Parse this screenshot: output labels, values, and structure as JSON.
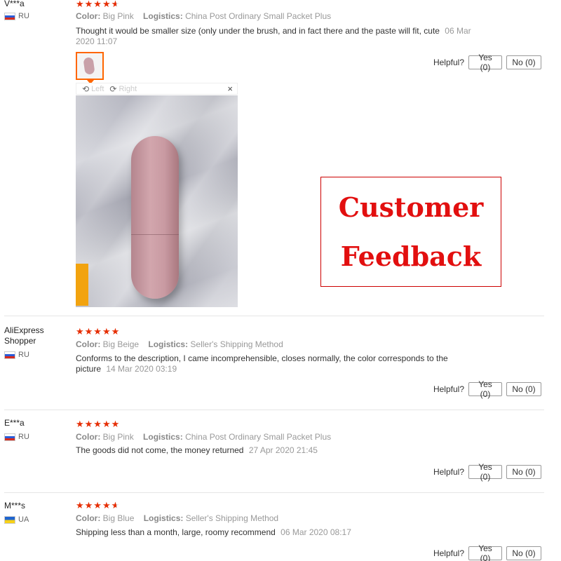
{
  "labels": {
    "color": "Color:",
    "logistics": "Logistics:",
    "helpful": "Helpful?",
    "rotate_left": "Left",
    "rotate_right": "Right",
    "close": "×"
  },
  "banner": {
    "line1": "Customer",
    "line2": "Feedback",
    "color": "#e20f0f"
  },
  "colors": {
    "star": "#e62e04",
    "thumb_border": "#ff6600"
  },
  "reviews": [
    {
      "user": "V***a",
      "country": "RU",
      "stars": 4.5,
      "color": "Big Pink",
      "logistics": "China Post Ordinary Small Packet Plus",
      "text": "Thought it would be smaller size (only under the brush, and in fact there and the paste will fit, cute",
      "date": "06 Mar 2020 11:07",
      "yes": "Yes (0)",
      "no": "No (0)"
    },
    {
      "user": "AliExpress Shopper",
      "country": "RU",
      "stars": 5,
      "color": "Big Beige",
      "logistics": "Seller's Shipping Method",
      "text": "Conforms to the description, I came incomprehensible, closes normally, the color corresponds to the picture",
      "date": "14 Mar 2020 03:19",
      "yes": "Yes (0)",
      "no": "No (0)"
    },
    {
      "user": "E***a",
      "country": "RU",
      "stars": 5,
      "color": "Big Pink",
      "logistics": "China Post Ordinary Small Packet Plus",
      "text": "The goods did not come, the money returned",
      "date": "27 Apr 2020 21:45",
      "yes": "Yes (0)",
      "no": "No (0)"
    },
    {
      "user": "M***s",
      "country": "UA",
      "stars": 4.5,
      "color": "Big Blue",
      "logistics": "Seller's Shipping Method",
      "text": "Shipping less than a month, large, roomy recommend",
      "date": "06 Mar 2020 08:17",
      "yes": "Yes (0)",
      "no": "No (0)"
    }
  ]
}
